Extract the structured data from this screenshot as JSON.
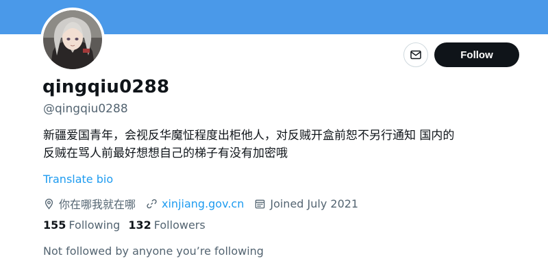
{
  "banner": {
    "color": "#4a99e9"
  },
  "profile": {
    "display_name": "qingqiu0288",
    "handle": "@qingqiu0288",
    "bio_lines": [
      "新疆爱国青年，会视反华魔怔程度出柜他人，对反贼开盒前恕不另行通知 国内的",
      "反贼在骂人前最好想想自己的梯子有没有加密哦"
    ],
    "translate_label": "Translate bio",
    "location": "你在哪我就在哪",
    "website": "xinjiang.gov.cn",
    "joined": "Joined July 2021",
    "following_count": "155",
    "following_label": "Following",
    "followers_count": "132",
    "followers_label": "Followers",
    "followed_note": "Not followed by anyone you’re following"
  },
  "actions": {
    "follow_label": "Follow",
    "message_icon": "envelope-icon"
  },
  "icons": {
    "location": "map-pin-icon",
    "website": "link-icon",
    "joined": "calendar-icon"
  },
  "colors": {
    "accent": "#1d9bf0",
    "secondary_text": "#536471",
    "primary_text": "#0f1419",
    "follow_button": "#0f1419"
  }
}
